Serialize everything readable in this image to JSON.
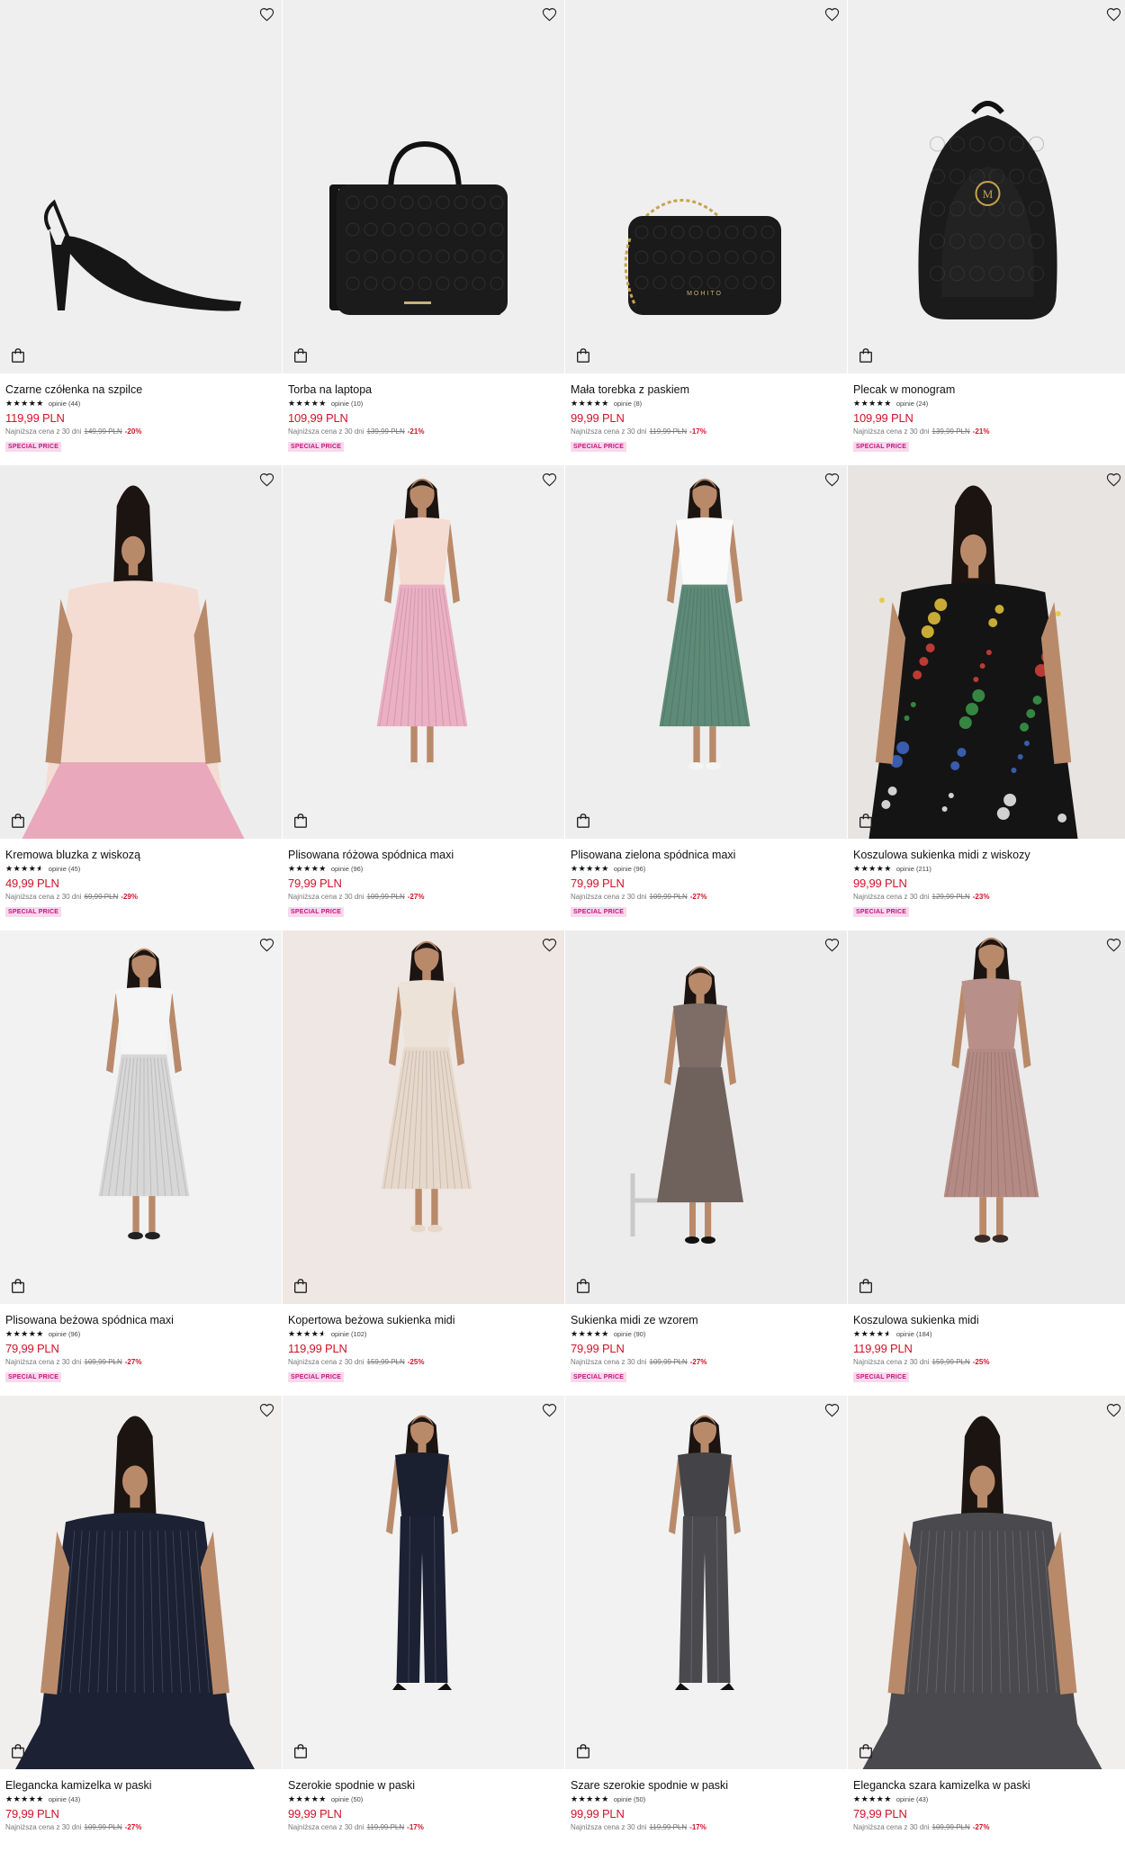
{
  "colors": {
    "price": "#d1132a",
    "badge_bg": "#f9d8ec",
    "badge_text": "#c4157f",
    "photo_bg": "#efefef"
  },
  "icons": {
    "favorite": "heart-outline-icon",
    "add_to_cart": "shopping-bag-icon"
  },
  "products": [
    {
      "name": "Czarne czółenka na szpilce",
      "rating_stars": 5,
      "reviews": "opinie (44)",
      "price": "119,99 PLN",
      "lowest_label": "Najniższa cena z 30 dni",
      "old_price": "149,99 PLN",
      "discount": "-20%",
      "badge": "SPECIAL PRICE",
      "image": "black-slingback-heel"
    },
    {
      "name": "Torba na laptopa",
      "rating_stars": 5,
      "reviews": "opinie (10)",
      "price": "109,99 PLN",
      "lowest_label": "Najniższa cena z 30 dni",
      "old_price": "139,99 PLN",
      "discount": "-21%",
      "badge": "SPECIAL PRICE",
      "image": "black-laptop-bag"
    },
    {
      "name": "Mała torebka z paskiem",
      "rating_stars": 5,
      "reviews": "opinie (8)",
      "price": "99,99 PLN",
      "lowest_label": "Najniższa cena z 30 dni",
      "old_price": "119,99 PLN",
      "discount": "-17%",
      "badge": "SPECIAL PRICE",
      "image": "black-chain-bag"
    },
    {
      "name": "Plecak w monogram",
      "rating_stars": 5,
      "reviews": "opinie (24)",
      "price": "109,99 PLN",
      "lowest_label": "Najniższa cena z 30 dni",
      "old_price": "139,99 PLN",
      "discount": "-21%",
      "badge": "SPECIAL PRICE",
      "image": "black-monogram-backpack"
    },
    {
      "name": "Kremowa bluzka z wiskozą",
      "rating_stars": 4.5,
      "reviews": "opinie (45)",
      "price": "49,99 PLN",
      "lowest_label": "Najniższa cena z 30 dni",
      "old_price": "69,99 PLN",
      "discount": "-29%",
      "badge": "SPECIAL PRICE",
      "image": "model-cream-blouse"
    },
    {
      "name": "Plisowana różowa spódnica maxi",
      "rating_stars": 5,
      "reviews": "opinie (96)",
      "price": "79,99 PLN",
      "lowest_label": "Najniższa cena z 30 dni",
      "old_price": "109,99 PLN",
      "discount": "-27%",
      "badge": "SPECIAL PRICE",
      "image": "model-pink-skirt"
    },
    {
      "name": "Plisowana zielona spódnica maxi",
      "rating_stars": 5,
      "reviews": "opinie (96)",
      "price": "79,99 PLN",
      "lowest_label": "Najniższa cena z 30 dni",
      "old_price": "109,99 PLN",
      "discount": "-27%",
      "badge": "SPECIAL PRICE",
      "image": "model-green-skirt"
    },
    {
      "name": "Koszulowa sukienka midi z wiskozy",
      "rating_stars": 5,
      "reviews": "opinie (211)",
      "price": "99,99 PLN",
      "lowest_label": "Najniższa cena z 30 dni",
      "old_price": "129,99 PLN",
      "discount": "-23%",
      "badge": "SPECIAL PRICE",
      "image": "model-floral-dress"
    },
    {
      "name": "Plisowana beżowa spódnica maxi",
      "rating_stars": 5,
      "reviews": "opinie (96)",
      "price": "79,99 PLN",
      "lowest_label": "Najniższa cena z 30 dni",
      "old_price": "109,99 PLN",
      "discount": "-27%",
      "badge": "SPECIAL PRICE",
      "image": "model-white-skirt"
    },
    {
      "name": "Kopertowa beżowa sukienka midi",
      "rating_stars": 4.5,
      "reviews": "opinie (102)",
      "price": "119,99 PLN",
      "lowest_label": "Najniższa cena z 30 dni",
      "old_price": "159,99 PLN",
      "discount": "-25%",
      "badge": "SPECIAL PRICE",
      "image": "model-beige-dress"
    },
    {
      "name": "Sukienka midi ze wzorem",
      "rating_stars": 5,
      "reviews": "opinie (90)",
      "price": "79,99 PLN",
      "lowest_label": "Najniższa cena z 30 dni",
      "old_price": "109,99 PLN",
      "discount": "-27%",
      "badge": "SPECIAL PRICE",
      "image": "model-patterned-dress"
    },
    {
      "name": "Koszulowa sukienka midi",
      "rating_stars": 4.5,
      "reviews": "opinie (184)",
      "price": "119,99 PLN",
      "lowest_label": "Najniższa cena z 30 dni",
      "old_price": "159,99 PLN",
      "discount": "-25%",
      "badge": "SPECIAL PRICE",
      "image": "model-pink-shirt-dress"
    },
    {
      "name": "Elegancka kamizelka w paski",
      "rating_stars": 5,
      "reviews": "opinie (43)",
      "price": "79,99 PLN",
      "lowest_label": "Najniższa cena z 30 dni",
      "old_price": "109,99 PLN",
      "discount": "-27%",
      "badge": "",
      "image": "model-navy-vest"
    },
    {
      "name": "Szerokie spodnie w paski",
      "rating_stars": 5,
      "reviews": "opinie (50)",
      "price": "99,99 PLN",
      "lowest_label": "Najniższa cena z 30 dni",
      "old_price": "119,99 PLN",
      "discount": "-17%",
      "badge": "",
      "image": "model-navy-trousers"
    },
    {
      "name": "Szare szerokie spodnie w paski",
      "rating_stars": 5,
      "reviews": "opinie (50)",
      "price": "99,99 PLN",
      "lowest_label": "Najniższa cena z 30 dni",
      "old_price": "119,99 PLN",
      "discount": "-17%",
      "badge": "",
      "image": "model-grey-trousers"
    },
    {
      "name": "Elegancka szara kamizelka w paski",
      "rating_stars": 5,
      "reviews": "opinie (43)",
      "price": "79,99 PLN",
      "lowest_label": "Najniższa cena z 30 dni",
      "old_price": "109,99 PLN",
      "discount": "-27%",
      "badge": "",
      "image": "model-grey-vest"
    }
  ]
}
